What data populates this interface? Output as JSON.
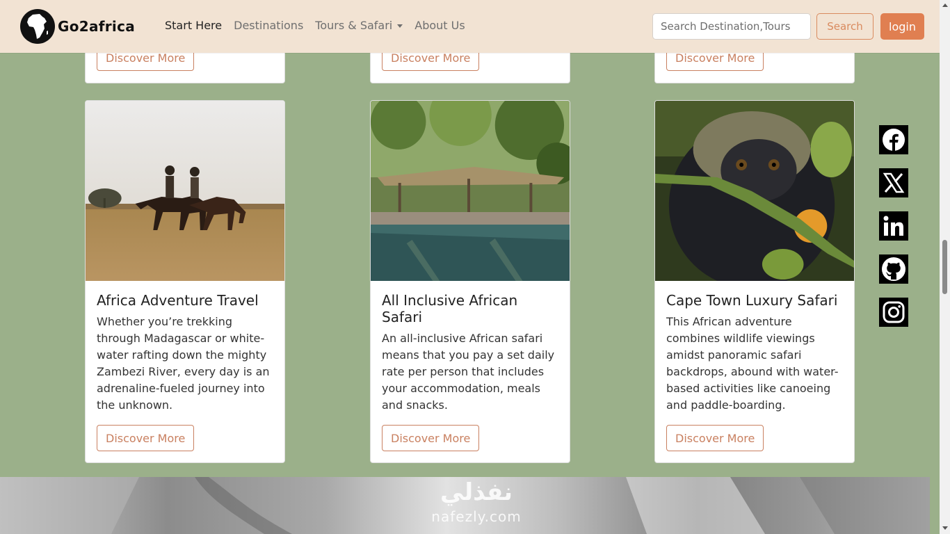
{
  "nav": {
    "logo_text": "Go2africa",
    "links": [
      {
        "label": "Start Here"
      },
      {
        "label": "Destinations"
      },
      {
        "label": "Tours & Safari"
      },
      {
        "label": "About Us"
      }
    ],
    "search_placeholder": "Search Destination,Tours",
    "search_label": "Search",
    "login_label": "login"
  },
  "top_cards": [
    {
      "button": "Discover More"
    },
    {
      "button": "Discover More"
    },
    {
      "button": "Discover More"
    }
  ],
  "cards": [
    {
      "title": "Africa Adventure Travel",
      "text": "Whether you’re trekking through Madagascar or white-water rafting down the mighty Zambezi River, every day is an adrenaline-fueled journey into the unknown.",
      "button": "Discover More"
    },
    {
      "title": "All Inclusive African Safari",
      "text": "An all-inclusive African safari means that you pay a set daily rate per person that includes your accommodation, meals and snacks.",
      "button": "Discover More"
    },
    {
      "title": "Cape Town Luxury Safari",
      "text": "This African adventure combines wildlife viewings amidst panoramic safari backdrops, abound with water-based activities like canoeing and paddle-boarding.",
      "button": "Discover More"
    }
  ],
  "social": [
    "facebook-icon",
    "x-icon",
    "linkedin-icon",
    "github-icon",
    "instagram-icon"
  ],
  "watermark": {
    "arabic": "نفذلي",
    "latin": "nafezly.com"
  },
  "colors": {
    "page_bg": "#9bb08a",
    "nav_bg": "#f2e3d3",
    "accent": "#e07f51"
  }
}
